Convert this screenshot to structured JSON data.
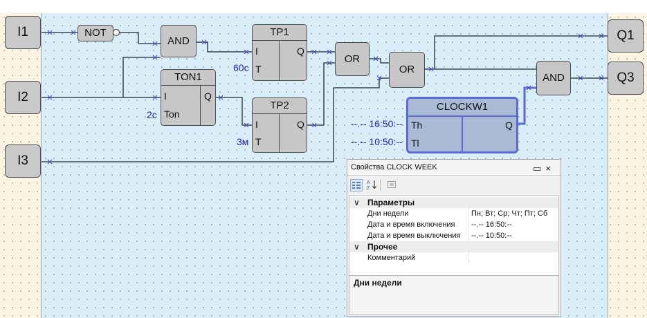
{
  "inputs": [
    {
      "label": "I1"
    },
    {
      "label": "I2"
    },
    {
      "label": "I3"
    }
  ],
  "outputs": [
    {
      "label": "Q1"
    },
    {
      "label": "Q3"
    }
  ],
  "blocks": {
    "not": {
      "title": "NOT"
    },
    "and1": {
      "title": "AND"
    },
    "ton1": {
      "title": "TON1",
      "pin_in": "I",
      "pin_t": "Ton",
      "pin_out": "Q"
    },
    "tp1": {
      "title": "TP1",
      "pin_in": "I",
      "pin_t": "T",
      "pin_out": "Q"
    },
    "tp2": {
      "title": "TP2",
      "pin_in": "I",
      "pin_t": "T",
      "pin_out": "Q"
    },
    "or1": {
      "title": "OR"
    },
    "or2": {
      "title": "OR"
    },
    "and2": {
      "title": "AND"
    },
    "clock": {
      "title": "CLOCKW1",
      "pin_on": "Th",
      "pin_off": "Tl",
      "pin_out": "Q"
    }
  },
  "params": {
    "tp1_time": "60с",
    "ton1_time": "2с",
    "tp2_time": "3м",
    "clock_on": "--.-- 16:50:--",
    "clock_off": "--.-- 10:50:--"
  },
  "properties_panel": {
    "title": "Свойства CLOCK WEEK",
    "pin_icon": "▭",
    "close_icon": "×",
    "categories": [
      {
        "name": "Параметры",
        "items": [
          {
            "name": "Дни недели",
            "value": "Пн; Вт; Ср; Чт; Пт; Сб"
          },
          {
            "name": "Дата и время включения",
            "value": "--.-- 16:50:--"
          },
          {
            "name": "Дата и время выключения",
            "value": "--.-- 10:50:--"
          }
        ]
      },
      {
        "name": "Прочее",
        "items": [
          {
            "name": "Комментарий",
            "value": ""
          }
        ]
      }
    ],
    "description": "Дни недели"
  },
  "colors": {
    "wire": "#1f2530",
    "selected": "#5a6ad6",
    "param_text": "#2323b8",
    "junction": "#4a4ac8"
  }
}
